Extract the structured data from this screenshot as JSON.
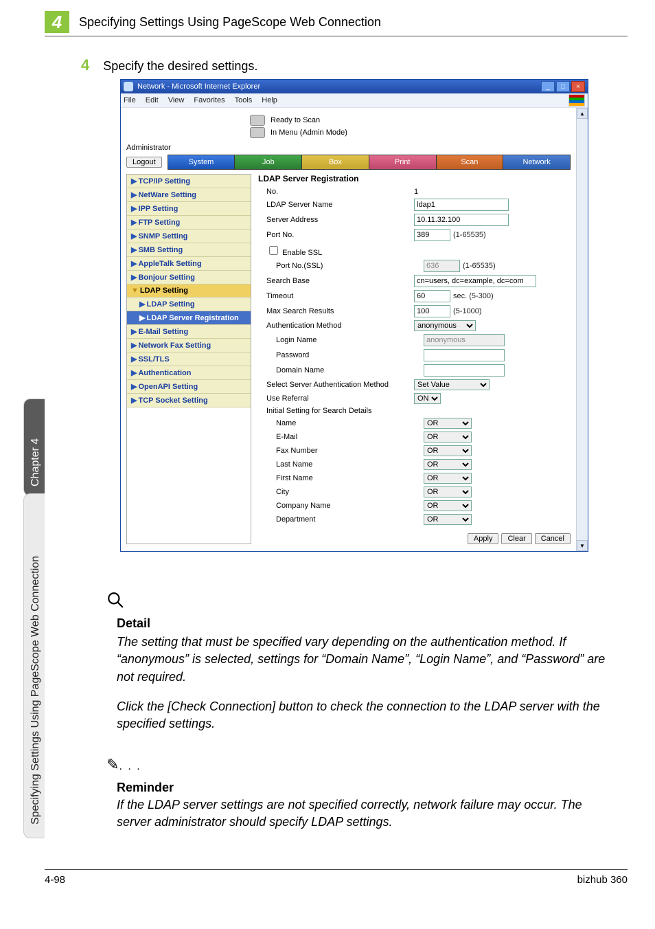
{
  "page": {
    "chapter_number": "4",
    "header_title": "Specifying Settings Using PageScope Web Connection",
    "side_chapter_label": "Chapter 4",
    "side_section_label": "Specifying Settings Using PageScope Web Connection",
    "footer_page": "4-98",
    "footer_model": "bizhub 360"
  },
  "step": {
    "number": "4",
    "text": "Specify the desired settings."
  },
  "browser": {
    "title": "Network - Microsoft Internet Explorer",
    "menus": [
      "File",
      "Edit",
      "View",
      "Favorites",
      "Tools",
      "Help"
    ],
    "status_lines": {
      "ready": "Ready to Scan",
      "mode": "In Menu (Admin Mode)"
    },
    "admin_label": "Administrator",
    "logout_label": "Logout",
    "tabs": [
      "System",
      "Job",
      "Box",
      "Print",
      "Scan",
      "Network"
    ]
  },
  "sidebar": {
    "items": [
      {
        "label": "TCP/IP Setting"
      },
      {
        "label": "NetWare Setting"
      },
      {
        "label": "IPP Setting"
      },
      {
        "label": "FTP Setting"
      },
      {
        "label": "SNMP Setting"
      },
      {
        "label": "SMB Setting"
      },
      {
        "label": "AppleTalk Setting"
      },
      {
        "label": "Bonjour Setting"
      },
      {
        "label": "LDAP Setting",
        "active": true
      },
      {
        "label": "LDAP Setting",
        "sub": true
      },
      {
        "label": "LDAP Server Registration",
        "subactive": true
      },
      {
        "label": "E-Mail Setting"
      },
      {
        "label": "Network Fax Setting"
      },
      {
        "label": "SSL/TLS"
      },
      {
        "label": "Authentication"
      },
      {
        "label": "OpenAPI Setting"
      },
      {
        "label": "TCP Socket Setting"
      }
    ]
  },
  "form": {
    "title": "LDAP Server Registration",
    "rows": {
      "no_label": "No.",
      "no_value": "1",
      "server_name_label": "LDAP Server Name",
      "server_name_value": "ldap1",
      "server_addr_label": "Server Address",
      "server_addr_value": "10.11.32.100",
      "port_label": "Port No.",
      "port_value": "389",
      "port_range": "(1-65535)",
      "enable_ssl_label": "Enable SSL",
      "port_ssl_label": "Port No.(SSL)",
      "port_ssl_value": "636",
      "port_ssl_range": "(1-65535)",
      "search_base_label": "Search Base",
      "search_base_value": "cn=users, dc=example, dc=com",
      "timeout_label": "Timeout",
      "timeout_value": "60",
      "timeout_range": "sec. (5-300)",
      "max_results_label": "Max Search Results",
      "max_results_value": "100",
      "max_results_range": "(5-1000)",
      "auth_method_label": "Authentication Method",
      "auth_method_value": "anonymous",
      "login_name_label": "Login Name",
      "login_name_value": "anonymous",
      "password_label": "Password",
      "password_value": "",
      "domain_label": "Domain Name",
      "domain_value": "",
      "select_auth_label": "Select Server Authentication Method",
      "select_auth_value": "Set Value",
      "referral_label": "Use Referral",
      "referral_value": "ON",
      "initial_label": "Initial Setting for Search Details",
      "attrs": {
        "name": "Name",
        "email": "E-Mail",
        "fax": "Fax Number",
        "lastname": "Last Name",
        "firstname": "First Name",
        "city": "City",
        "company": "Company Name",
        "department": "Department"
      },
      "attr_value": "OR"
    },
    "buttons": {
      "apply": "Apply",
      "clear": "Clear",
      "cancel": "Cancel"
    }
  },
  "detail": {
    "heading": "Detail",
    "p1": "The setting that must be specified vary depending on the authentication method. If “anonymous” is selected, settings for “Domain Name”, “Login Name”, and “Password” are not required.",
    "p2": "Click the [Check Connection] button to check the connection to the LDAP server with the specified settings."
  },
  "reminder": {
    "icon": "✎",
    "dots": ". . .",
    "heading": "Reminder",
    "body": "If the LDAP server settings are not specified correctly, network failure may occur. The server administrator should specify LDAP settings."
  }
}
